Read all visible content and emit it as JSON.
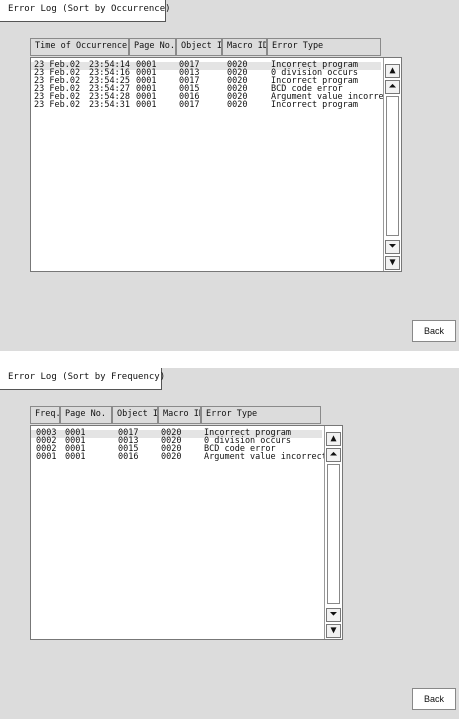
{
  "occurrence": {
    "tab_title": "Error Log (Sort by Occurrence)",
    "headers": [
      "Time of Occurrence",
      "Page No.",
      "Object ID",
      "Macro ID",
      "Error Type"
    ],
    "rows": [
      [
        "23 Feb.02",
        "23:54:14",
        "0001",
        "0017",
        "0020",
        "Incorrect program"
      ],
      [
        "23 Feb.02",
        "23:54:16",
        "0001",
        "0013",
        "0020",
        "0 division occurs"
      ],
      [
        "23 Feb.02",
        "23:54:25",
        "0001",
        "0017",
        "0020",
        "Incorrect program"
      ],
      [
        "23 Feb.02",
        "23:54:27",
        "0001",
        "0015",
        "0020",
        "BCD code error"
      ],
      [
        "23 Feb.02",
        "23:54:28",
        "0001",
        "0016",
        "0020",
        "Argument value incorrect"
      ],
      [
        "23 Feb.02",
        "23:54:31",
        "0001",
        "0017",
        "0020",
        "Incorrect program"
      ]
    ],
    "back_label": "Back"
  },
  "frequency": {
    "tab_title": "Error Log (Sort by Frequency)",
    "headers": [
      "Freq.",
      "Page No.",
      "Object ID",
      "Macro ID",
      "Error Type"
    ],
    "rows": [
      [
        "0003",
        "0001",
        "0017",
        "0020",
        "Incorrect program"
      ],
      [
        "0002",
        "0001",
        "0013",
        "0020",
        "0 division occurs"
      ],
      [
        "0002",
        "0001",
        "0015",
        "0020",
        "BCD code error"
      ],
      [
        "0001",
        "0001",
        "0016",
        "0020",
        "Argument value incorrect"
      ]
    ],
    "back_label": "Back"
  },
  "scroll_icons": {
    "up": "arrow-up-icon",
    "page_up": "double-arrow-up-icon",
    "page_down": "double-arrow-down-icon",
    "down": "arrow-down-icon"
  },
  "colors": {
    "screen_bg": "#dcdcdc",
    "selected_row": "#e4e4e4"
  }
}
